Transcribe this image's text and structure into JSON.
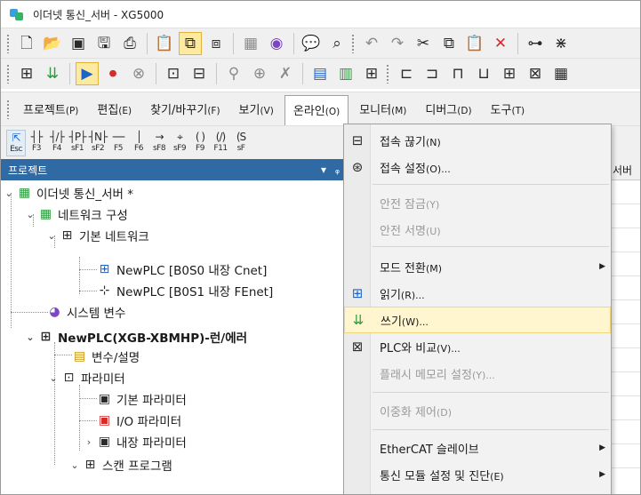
{
  "window": {
    "title": "이더넷 통신_서버 - XG5000"
  },
  "toolbar1": {
    "icons": [
      "new-file-icon",
      "open-folder-icon",
      "open-project-icon",
      "save-icon",
      "print-icon",
      "clipboard-icon",
      "connect-plc-icon",
      "disconnect-icon",
      "monitor-icon",
      "record-icon",
      "comment-icon",
      "find-icon",
      "undo-icon",
      "redo-icon",
      "cut-icon",
      "copy-icon",
      "paste-icon",
      "delete-icon",
      "network-icon",
      "scan-icon"
    ]
  },
  "toolbar2": {
    "icons": [
      "online-connect-icon",
      "write-icon",
      "run-icon",
      "stop-icon",
      "pause-icon",
      "plc-icon",
      "param-icon",
      "link-icon",
      "network-check-icon",
      "cut-network-icon",
      "display-icon",
      "compare-icon",
      "config-icon",
      "ladder-icon",
      "ladder2-icon",
      "ladder3-icon",
      "device-icon",
      "table-icon",
      "window-icon",
      "chart-icon"
    ]
  },
  "menubar": {
    "items": [
      {
        "label": "프로젝트",
        "acc": "(P)"
      },
      {
        "label": "편집",
        "acc": "(E)"
      },
      {
        "label": "찾기/바꾸기",
        "acc": "(F)"
      },
      {
        "label": "보기",
        "acc": "(V)"
      },
      {
        "label": "온라인",
        "acc": "(O)"
      },
      {
        "label": "모니터",
        "acc": "(M)"
      },
      {
        "label": "디버그",
        "acc": "(D)"
      },
      {
        "label": "도구",
        "acc": "(T)"
      }
    ]
  },
  "fkeys": [
    {
      "sym": "⇱",
      "lbl": "Esc"
    },
    {
      "sym": "┤├",
      "lbl": "F3"
    },
    {
      "sym": "┤/├",
      "lbl": "F4"
    },
    {
      "sym": "┤P├",
      "lbl": "sF1"
    },
    {
      "sym": "┤N├",
      "lbl": "sF2"
    },
    {
      "sym": "──",
      "lbl": "F5"
    },
    {
      "sym": "│",
      "lbl": "F6"
    },
    {
      "sym": "→",
      "lbl": "sF8"
    },
    {
      "sym": "⌖",
      "lbl": "sF9"
    },
    {
      "sym": "( )",
      "lbl": "F9"
    },
    {
      "sym": "(/)",
      "lbl": "F11"
    },
    {
      "sym": "(S",
      "lbl": "sF"
    }
  ],
  "project_panel": {
    "header": "프로젝트",
    "pin": "ᵩ",
    "nodes": [
      {
        "label": "이더넷 통신_서버 *"
      },
      {
        "label": "네트워크 구성"
      },
      {
        "label": "기본 네트워크"
      },
      {
        "label": "NewPLC [B0S0 내장 Cnet]"
      },
      {
        "label": "NewPLC [B0S1 내장 FEnet]"
      },
      {
        "label": "시스템 변수"
      },
      {
        "label": "NewPLC(XGB-XBMHP)-런/에러"
      },
      {
        "label": "변수/설명"
      },
      {
        "label": "파라미터"
      },
      {
        "label": "기본 파라미터"
      },
      {
        "label": "I/O 파라미터"
      },
      {
        "label": "내장 파라미터"
      },
      {
        "label": "스캔 프로그램"
      }
    ]
  },
  "right_panel": {
    "header": "서버"
  },
  "online_menu": {
    "items": [
      {
        "label": "접속 끊기",
        "acc": "(N)"
      },
      {
        "label": "접속 설정",
        "acc": "(O)..."
      },
      {
        "label": "안전 잠금",
        "acc": "(Y)"
      },
      {
        "label": "안전 서명",
        "acc": "(U)"
      },
      {
        "label": "모드 전환",
        "acc": "(M)"
      },
      {
        "label": "읽기",
        "acc": "(R)..."
      },
      {
        "label": "쓰기",
        "acc": "(W)..."
      },
      {
        "label": "PLC와 비교",
        "acc": "(V)..."
      },
      {
        "label": "플래시 메모리 설정",
        "acc": "(Y)..."
      },
      {
        "label": "이중화 제어",
        "acc": "(D)"
      },
      {
        "label": "EtherCAT 슬레이브",
        "acc": ""
      },
      {
        "label": "통신 모듈 설정 및 진단",
        "acc": "(E)"
      }
    ]
  },
  "colors": {
    "panel_header": "#2f6aa5",
    "highlight": "#fff6d0",
    "menu_bg": "#f2f2f2"
  }
}
